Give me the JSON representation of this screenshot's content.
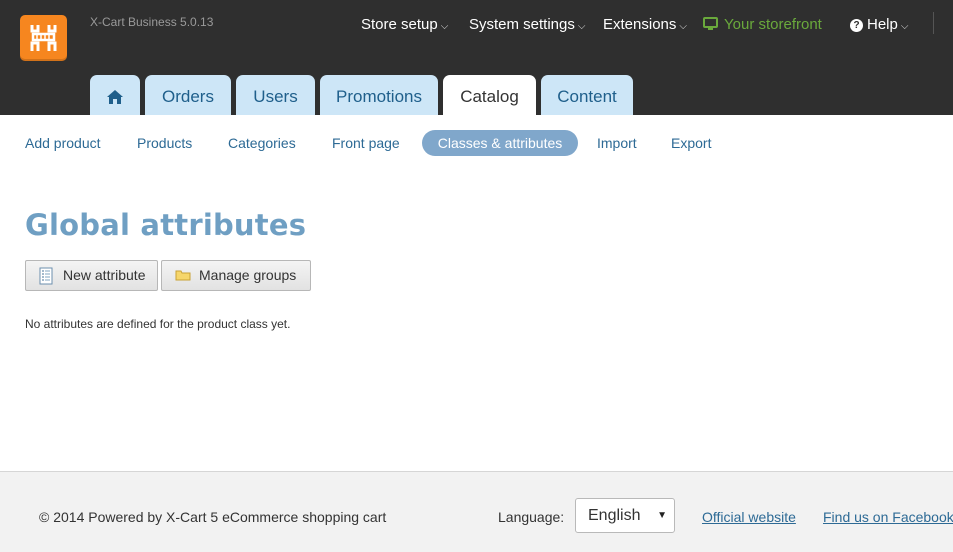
{
  "app": {
    "version": "X-Cart Business 5.0.13"
  },
  "topnav": {
    "store_setup": "Store setup",
    "system_settings": "System settings",
    "extensions": "Extensions",
    "storefront": "Your storefront",
    "help": "Help",
    "chevron": "⌵"
  },
  "tabs": [
    {
      "label": "",
      "icon": "home-icon"
    },
    {
      "label": "Orders"
    },
    {
      "label": "Users"
    },
    {
      "label": "Promotions"
    },
    {
      "label": "Catalog",
      "active": true
    },
    {
      "label": "Content"
    }
  ],
  "subnav": {
    "items": [
      "Add product",
      "Products",
      "Categories",
      "Front page",
      "Classes & attributes",
      "Import",
      "Export"
    ],
    "active": "Classes & attributes"
  },
  "main": {
    "title": "Global attributes",
    "new_attribute_label": "New attribute",
    "manage_groups_label": "Manage groups",
    "empty_message": "No attributes are defined for the product class yet."
  },
  "footer": {
    "copyright": "© 2014 Powered by X-Cart 5 eCommerce shopping cart",
    "language_label": "Language:",
    "language_value": "English",
    "official_website": "Official website",
    "facebook": "Find us on Facebook"
  },
  "colors": {
    "topbar": "#2f2f2f",
    "logo": "#f6861f",
    "tab": "#cde6f7",
    "pill": "#80a7cb",
    "title": "#6f9fc3",
    "link": "#2d6a95",
    "storefront": "#6aa93c"
  }
}
